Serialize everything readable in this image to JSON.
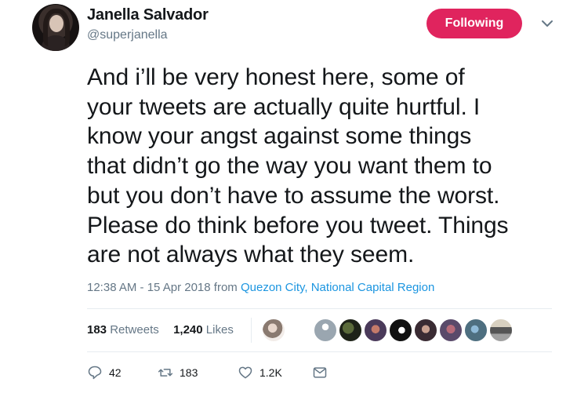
{
  "user": {
    "name": "Janella Salvador",
    "handle": "@superjanella",
    "follow_label": "Following"
  },
  "tweet": {
    "text": "And i’ll be very honest here, some of\nyour tweets are actually quite hurtful. I\nknow your angst against some things\nthat didn’t go the way you want them to\nbut you don’t have to assume the worst.\nPlease do think before you tweet. Things\nare not always what they seem.",
    "time": "12:38 AM - 15 Apr 2018",
    "from_label": "from",
    "location": "Quezon City, National Capital Region"
  },
  "stats": {
    "retweets_count": "183",
    "retweets_label": "Retweets",
    "likes_count": "1,240",
    "likes_label": "Likes"
  },
  "actions": {
    "reply_count": "42",
    "retweet_count": "183",
    "like_count": "1.2K"
  },
  "icons": {
    "follow_menu": "chevron-down-icon",
    "reply": "reply-icon",
    "retweet": "retweet-icon",
    "like": "heart-icon",
    "dm": "envelope-icon"
  },
  "colors": {
    "follow_button": "#e0245e",
    "link": "#1b95e0",
    "muted": "#657786"
  }
}
